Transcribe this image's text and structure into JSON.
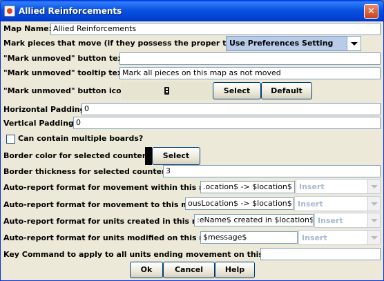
{
  "window": {
    "title": "Allied Reinforcements"
  },
  "fields": {
    "map_name": {
      "label": "Map Name:",
      "value": "Allied Reinforcements"
    },
    "mark_pieces": {
      "label": "Mark pieces that move (if they possess the proper trait):",
      "selected": "Use Preferences Setting"
    },
    "mark_unmoved_text": {
      "label": "\"Mark unmoved\" button text:",
      "value": ""
    },
    "mark_unmoved_tooltip": {
      "label": "\"Mark unmoved\" tooltip text:",
      "value": "Mark all pieces on this map as not moved"
    },
    "mark_unmoved_icon": {
      "label": "\"Mark unmoved\" button icon:",
      "select_label": "Select",
      "default_label": "Default"
    },
    "horizontal_padding": {
      "label": "Horizontal Padding:",
      "value": "0"
    },
    "vertical_padding": {
      "label": "Vertical Padding:",
      "value": "0"
    },
    "multiple_boards": {
      "label": "Can contain multiple boards?",
      "checked": false
    },
    "border_color": {
      "label": "Border color for selected counters:",
      "select_label": "Select",
      "color": "#000000"
    },
    "border_thickness": {
      "label": "Border thickness for selected counters:",
      "value": "3"
    },
    "report_within": {
      "label": "Auto-report format for movement within this map:",
      "value": ".ocation$ -> $location$ *",
      "insert_label": "Insert"
    },
    "report_to": {
      "label": "Auto-report format for movement to this map:",
      "value": "ousLocation$ -> $location$ *",
      "insert_label": "Insert"
    },
    "report_created": {
      "label": "Auto-report format for units created in this map:",
      "value": ":eName$ created in $location$",
      "insert_label": "Insert"
    },
    "report_modified": {
      "label": "Auto-report format for units modified on this map:",
      "value": "$message$",
      "insert_label": "Insert"
    },
    "key_command": {
      "label": "Key Command to apply to all units ending movement on this map:",
      "value": ""
    }
  },
  "footer": {
    "ok_label": "Ok",
    "cancel_label": "Cancel",
    "help_label": "Help"
  },
  "colors": {
    "titlebar": "#0a52e0",
    "dialog_bg": "#ece9d8",
    "combo_selected_bg": "#b8cbe8"
  }
}
